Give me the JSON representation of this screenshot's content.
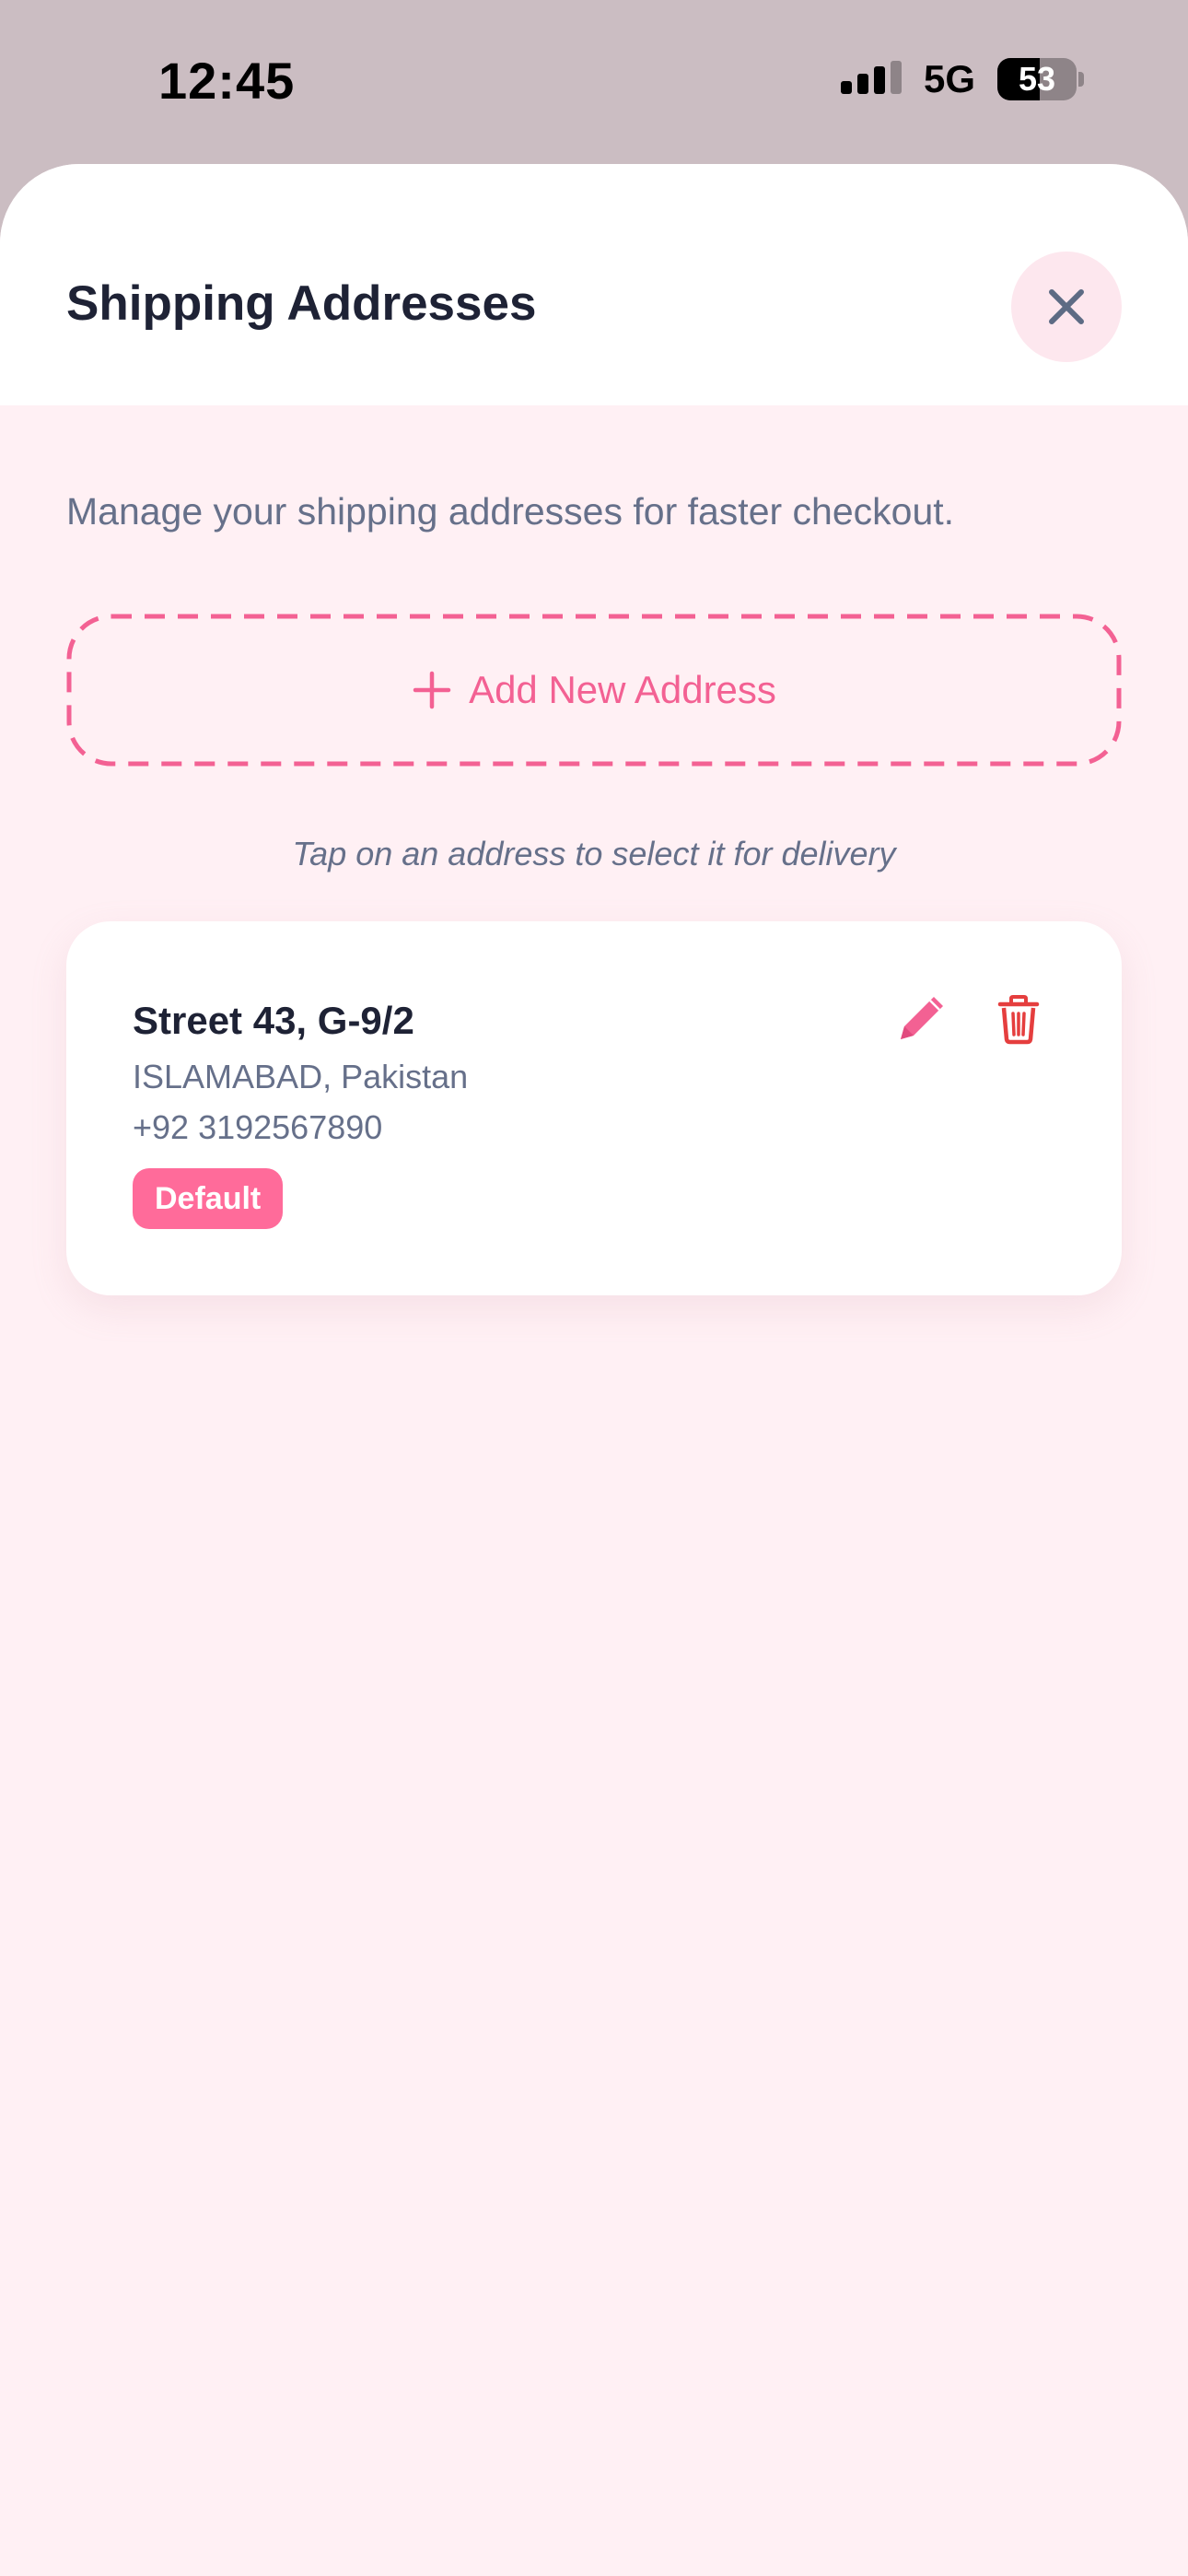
{
  "status_bar": {
    "time": "12:45",
    "network": "5G",
    "battery_level": "53",
    "battery_fraction": 0.53,
    "signal_icon": "signal-bars-icon",
    "battery_icon": "battery-icon"
  },
  "sheet": {
    "title": "Shipping Addresses",
    "close_icon": "close-icon"
  },
  "content": {
    "subtitle": "Manage your shipping addresses for faster checkout.",
    "add_button_label": "Add New Address",
    "add_icon": "plus-icon",
    "hint": "Tap on an address to select it for delivery"
  },
  "addresses": [
    {
      "line1": "Street 43, G-9/2",
      "line2": "ISLAMABAD, Pakistan",
      "phone": "+92 3192567890",
      "badge": "Default",
      "edit_icon": "pencil-icon",
      "delete_icon": "trash-icon"
    }
  ],
  "colors": {
    "accent": "#ff6b9a",
    "accent_text": "#f36193",
    "danger": "#e53e3e",
    "background": "#fff0f4",
    "title_text": "#1e2235",
    "muted_text": "#66708a"
  }
}
